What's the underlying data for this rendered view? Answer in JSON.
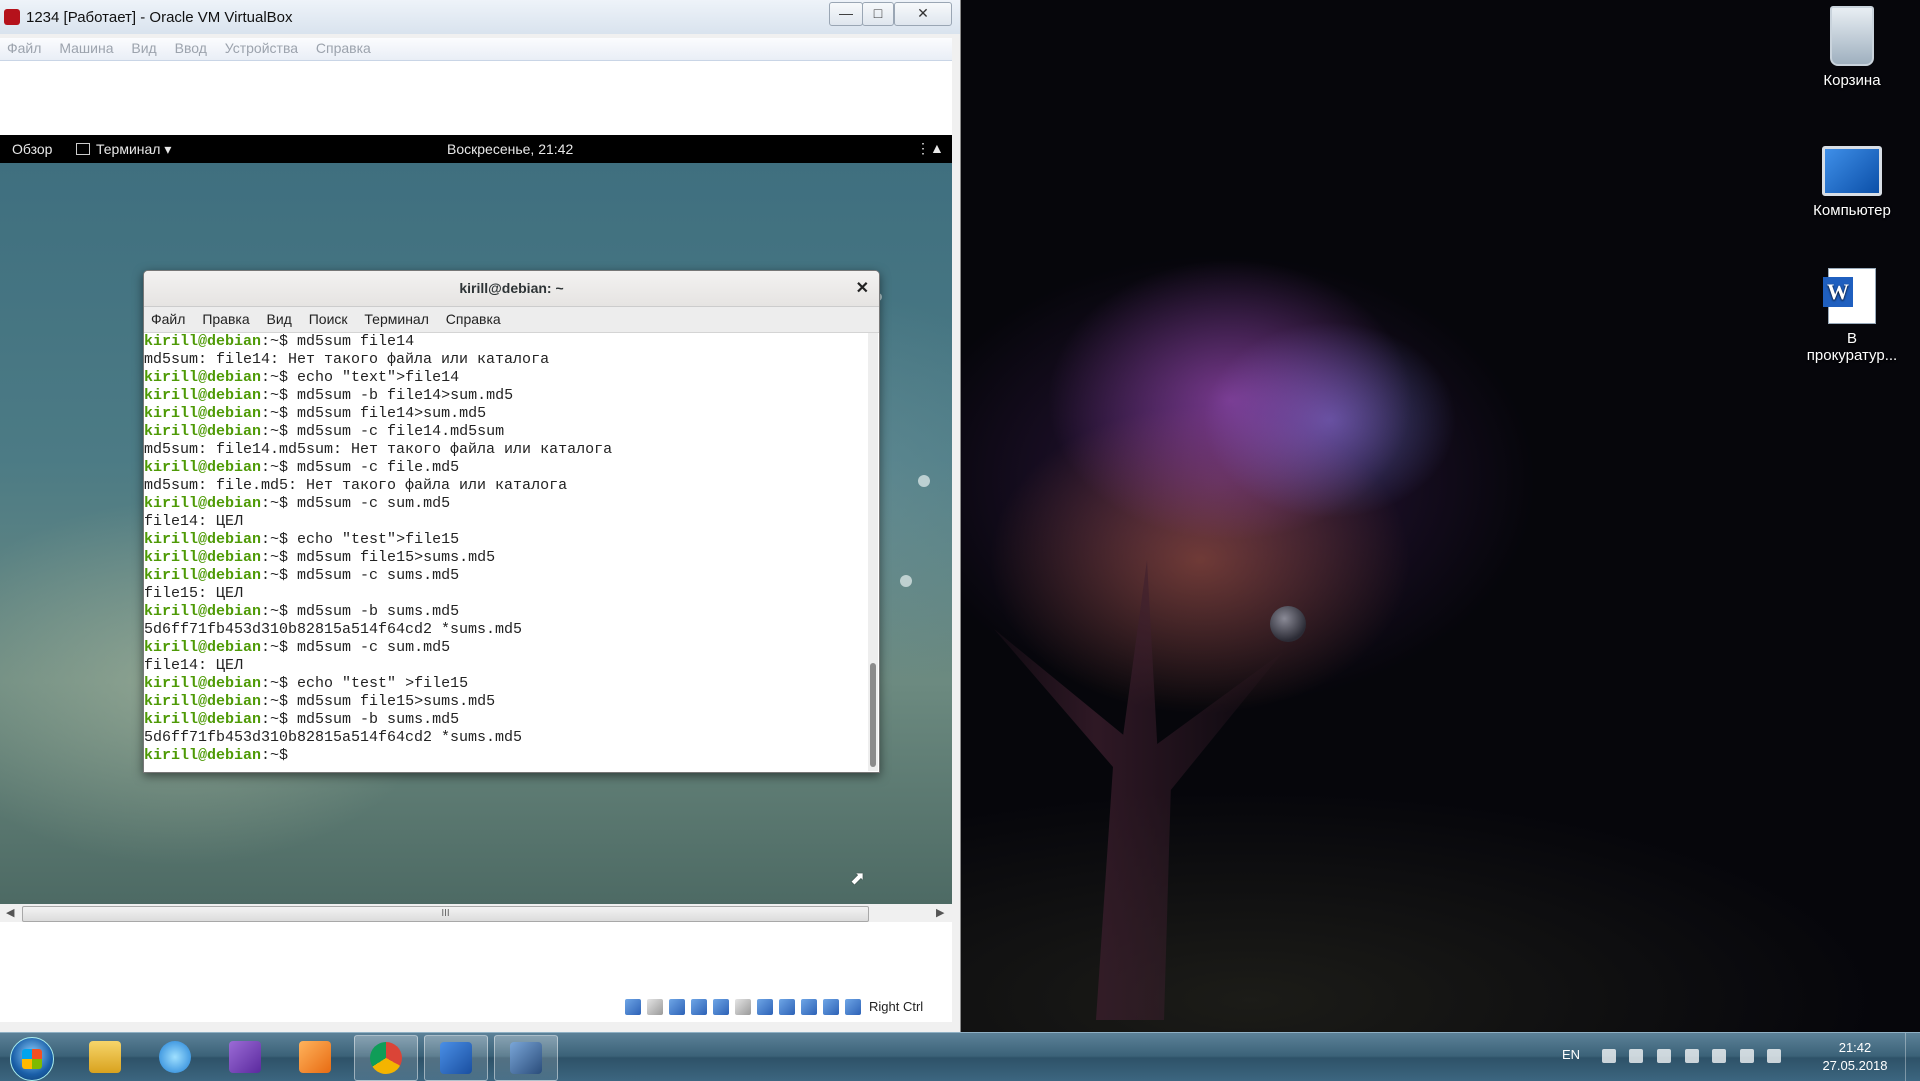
{
  "vbox": {
    "title": "1234 [Работает] - Oracle VM VirtualBox",
    "menu": [
      "Файл",
      "Машина",
      "Вид",
      "Ввод",
      "Устройства",
      "Справка"
    ],
    "host_key": "Right Ctrl",
    "scroll_grip": "III"
  },
  "gnome": {
    "activities": "Обзор",
    "app_menu": "Терминал ▾",
    "clock": "Воскресенье, 21:42"
  },
  "terminal": {
    "title": "kirill@debian: ~",
    "menu": [
      "Файл",
      "Правка",
      "Вид",
      "Поиск",
      "Терминал",
      "Справка"
    ],
    "prompt": "kirill@debian",
    "prompt_suffix": ":~$ ",
    "lines": [
      {
        "p": true,
        "t": "md5sum file14"
      },
      {
        "p": false,
        "t": "md5sum: file14: Нет такого файла или каталога"
      },
      {
        "p": true,
        "t": "echo \"text\">file14"
      },
      {
        "p": true,
        "t": "md5sum -b file14>sum.md5"
      },
      {
        "p": true,
        "t": "md5sum file14>sum.md5"
      },
      {
        "p": true,
        "t": "md5sum -c file14.md5sum"
      },
      {
        "p": false,
        "t": "md5sum: file14.md5sum: Нет такого файла или каталога"
      },
      {
        "p": true,
        "t": "md5sum -c file.md5"
      },
      {
        "p": false,
        "t": "md5sum: file.md5: Нет такого файла или каталога"
      },
      {
        "p": true,
        "t": "md5sum -c sum.md5"
      },
      {
        "p": false,
        "t": "file14: ЦЕЛ"
      },
      {
        "p": true,
        "t": "echo \"test\">file15"
      },
      {
        "p": true,
        "t": "md5sum file15>sums.md5"
      },
      {
        "p": true,
        "t": "md5sum -c sums.md5"
      },
      {
        "p": false,
        "t": "file15: ЦЕЛ"
      },
      {
        "p": true,
        "t": "md5sum -b sums.md5"
      },
      {
        "p": false,
        "t": "5d6ff71fb453d310b82815a514f64cd2 *sums.md5"
      },
      {
        "p": true,
        "t": "md5sum -c sum.md5"
      },
      {
        "p": false,
        "t": "file14: ЦЕЛ"
      },
      {
        "p": true,
        "t": "echo \"test\" >file15"
      },
      {
        "p": true,
        "t": "md5sum file15>sums.md5"
      },
      {
        "p": true,
        "t": "md5sum -b sums.md5"
      },
      {
        "p": false,
        "t": "5d6ff71fb453d310b82815a514f64cd2 *sums.md5"
      },
      {
        "p": true,
        "t": ""
      }
    ]
  },
  "desktop": {
    "icons": [
      {
        "name": "recycle-bin",
        "label": "Корзина"
      },
      {
        "name": "computer",
        "label": "Компьютер"
      },
      {
        "name": "word-document",
        "label": "В прокуратур..."
      }
    ]
  },
  "taskbar": {
    "lang": "EN",
    "time": "21:42",
    "date": "27.05.2018",
    "pinned": [
      "explorer-icon",
      "ie-icon",
      "visual-studio-icon",
      "media-player-icon",
      "chrome-icon",
      "word-icon",
      "virtualbox-icon"
    ]
  }
}
